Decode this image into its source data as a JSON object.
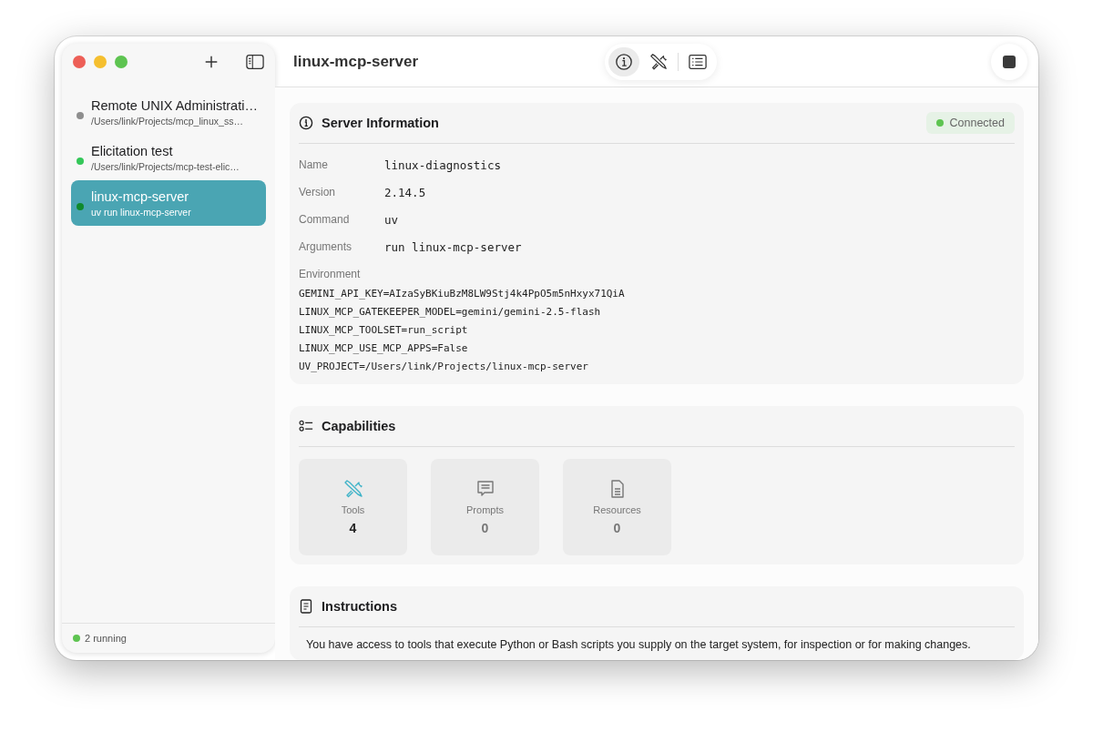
{
  "sidebar": {
    "items": [
      {
        "title": "Remote UNIX Administrati…",
        "subtitle": "/Users/link/Projects/mcp_linux_ss…",
        "color": "#8e8e8e",
        "selected": false
      },
      {
        "title": "Elicitation test",
        "subtitle": "/Users/link/Projects/mcp-test-elic…",
        "color": "#34c759",
        "selected": false
      },
      {
        "title": "linux-mcp-server",
        "subtitle": "uv run linux-mcp-server",
        "color": "#0f8a2c",
        "selected": true
      }
    ],
    "status": "2 running"
  },
  "header": {
    "title": "linux-mcp-server",
    "views": [
      {
        "kind": "info",
        "selected": true
      },
      {
        "kind": "tools",
        "selected": false
      },
      {
        "kind": "log",
        "selected": false
      }
    ]
  },
  "server_info": {
    "title": "Server Information",
    "status": "Connected",
    "fields": [
      {
        "label": "Name",
        "value": "linux-diagnostics"
      },
      {
        "label": "Version",
        "value": "2.14.5"
      },
      {
        "label": "Command",
        "value": "uv"
      },
      {
        "label": "Arguments",
        "value": "run linux-mcp-server"
      }
    ],
    "environment_label": "Environment",
    "environment": [
      "GEMINI_API_KEY=AIzaSyBKiuBzM8LW9Stj4k4PpO5m5nHxyx71QiA",
      "LINUX_MCP_GATEKEEPER_MODEL=gemini/gemini-2.5-flash",
      "LINUX_MCP_TOOLSET=run_script",
      "LINUX_MCP_USE_MCP_APPS=False",
      "UV_PROJECT=/Users/link/Projects/linux-mcp-server"
    ]
  },
  "capabilities": {
    "title": "Capabilities",
    "tiles": [
      {
        "kind": "tools",
        "label": "Tools",
        "count": "4",
        "enabled": true
      },
      {
        "kind": "prompts",
        "label": "Prompts",
        "count": "0",
        "enabled": false
      },
      {
        "kind": "resources",
        "label": "Resources",
        "count": "0",
        "enabled": false
      }
    ]
  },
  "instructions": {
    "title": "Instructions",
    "text": "You have access to tools that execute Python or Bash scripts you supply on the target system, for inspection or for making changes."
  }
}
